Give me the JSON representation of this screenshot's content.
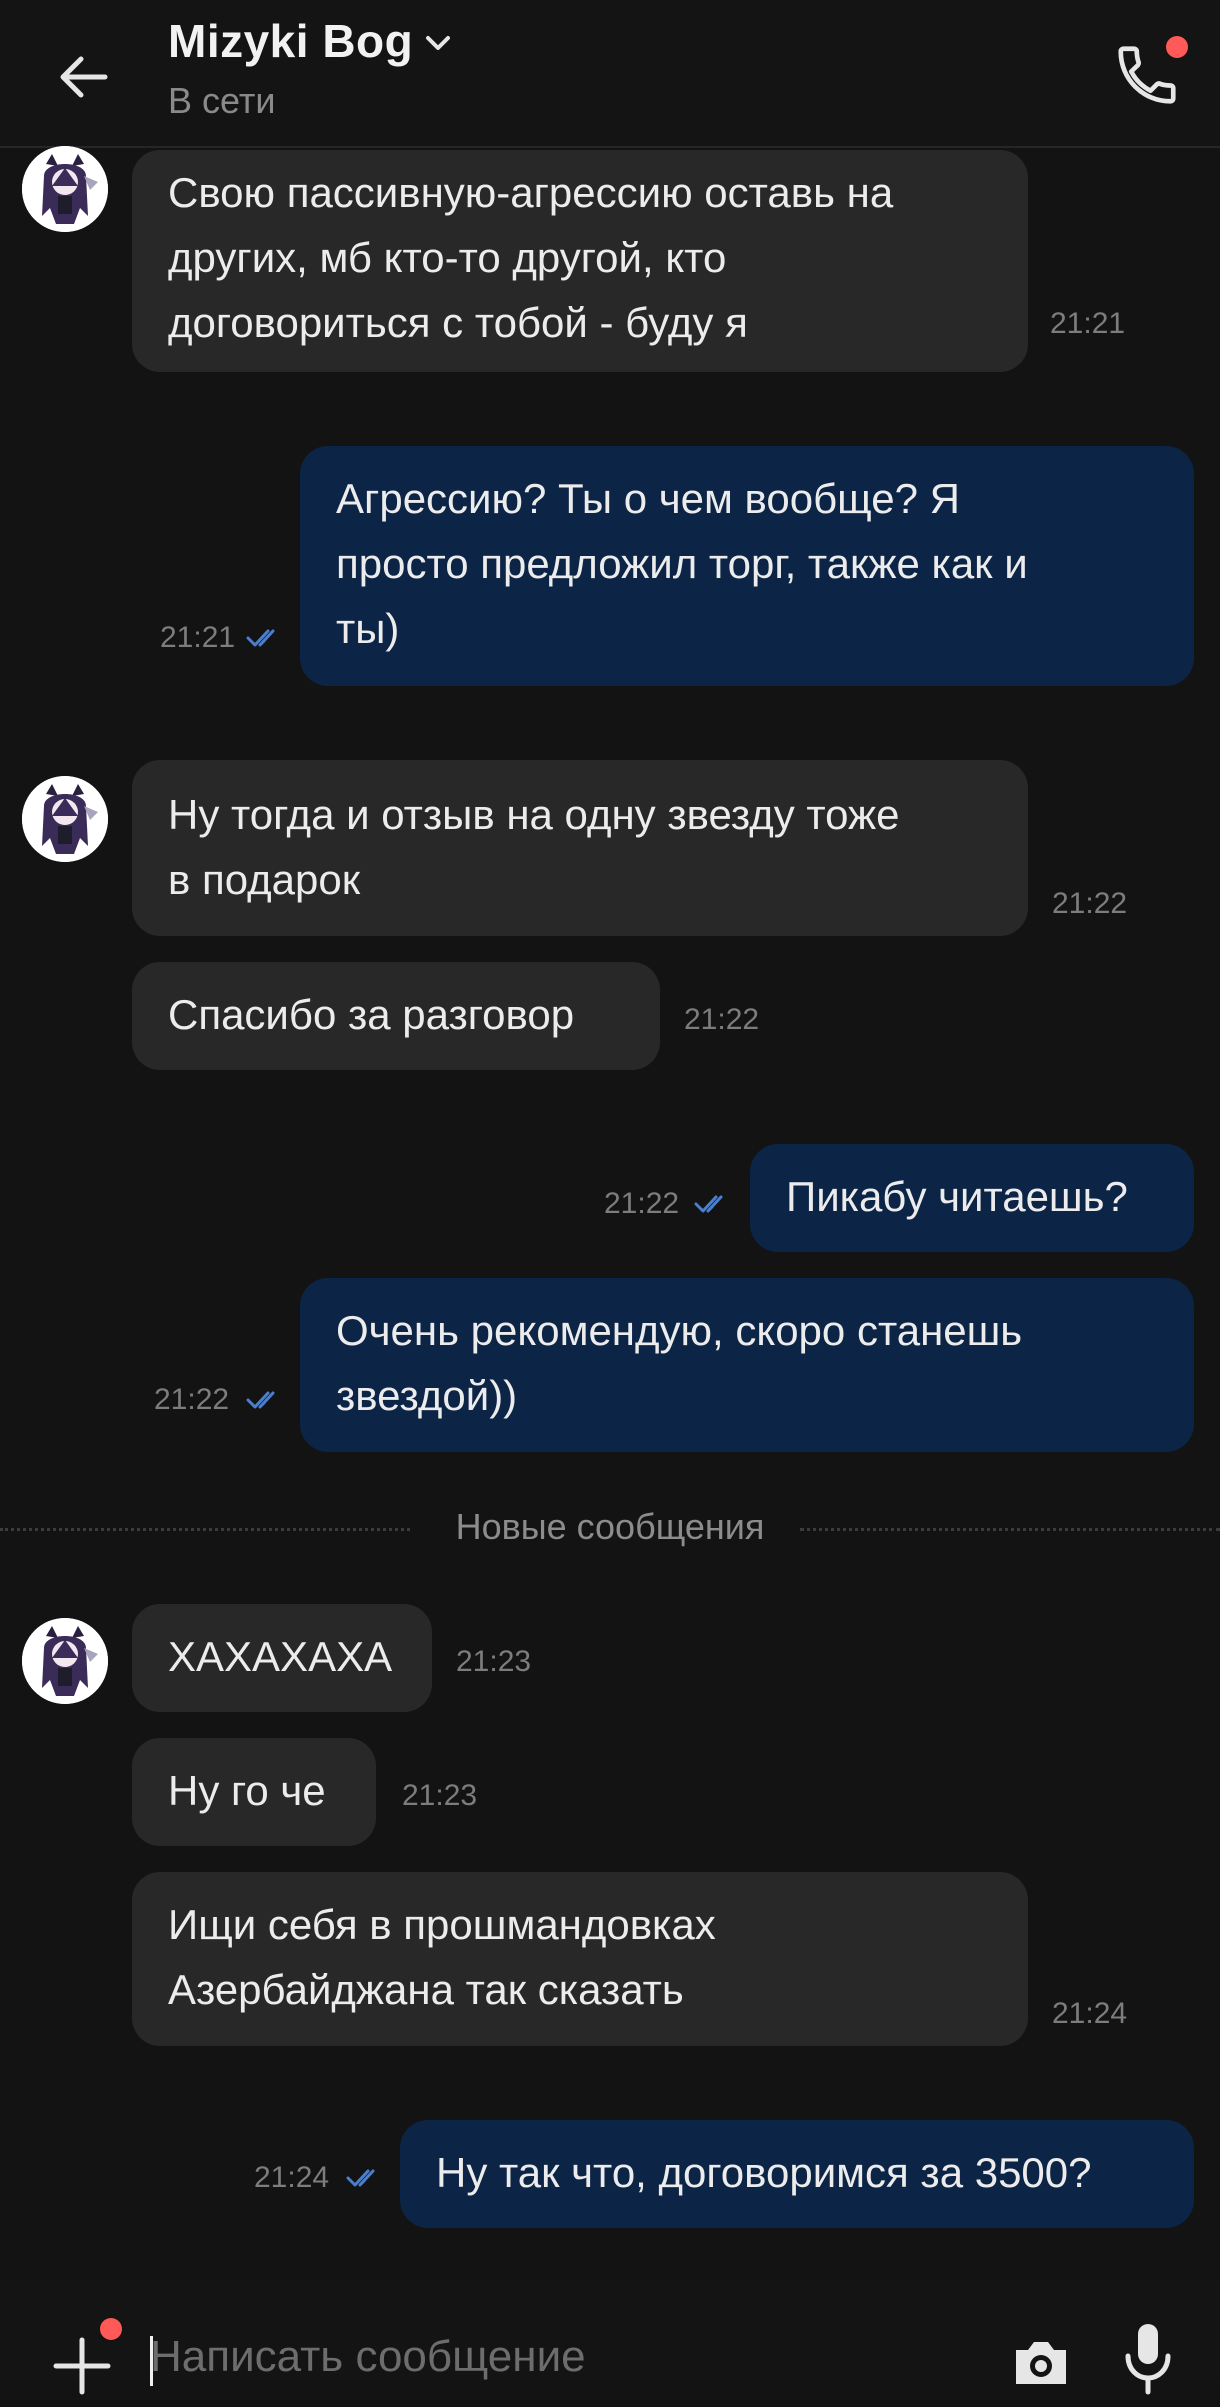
{
  "header": {
    "contact_name": "Mizyki Bog",
    "status": "В сети",
    "back_icon": "arrow-left-icon",
    "chevron_icon": "chevron-down-icon",
    "call_icon": "phone-icon",
    "accent_dot_color": "#ff5a57"
  },
  "messages": [
    {
      "direction": "in",
      "text": "Свою пассивную-агрессию оставь на\nдругих, мб кто-то другой, кто\nдоговориться с тобой - буду я",
      "time": "21:21"
    },
    {
      "direction": "out",
      "text": "Агрессию? Ты о чем вообще? Я\nпросто предложил торг, также как и\nты)",
      "time": "21:21",
      "status": "read"
    },
    {
      "direction": "in",
      "text": "Ну тогда и отзыв на одну звезду тоже\nв подарок",
      "time": "21:22"
    },
    {
      "direction": "in",
      "text": "Спасибо за разговор",
      "time": "21:22"
    },
    {
      "direction": "out",
      "text": "Пикабу читаешь?",
      "time": "21:22",
      "status": "read"
    },
    {
      "direction": "out",
      "text": "Очень рекомендую, скоро станешь\nзвездой))",
      "time": "21:22",
      "status": "read"
    },
    {
      "direction": "in",
      "text": "ХАХАХАХА",
      "time": "21:23"
    },
    {
      "direction": "in",
      "text": "Ну го че",
      "time": "21:23"
    },
    {
      "direction": "in",
      "text": "Ищи себя в прошмандовках\nАзербайджана так сказать",
      "time": "21:24"
    },
    {
      "direction": "out",
      "text": "Ну так что, договоримся за 3500?",
      "time": "21:24",
      "status": "read"
    }
  ],
  "divider": {
    "label": "Новые сообщения"
  },
  "composer": {
    "placeholder": "Написать сообщение",
    "attach_icon": "plus-icon",
    "camera_icon": "camera-icon",
    "mic_icon": "microphone-icon"
  },
  "colors": {
    "background": "#131313",
    "incoming_bubble": "#282828",
    "outgoing_bubble": "#0c2446",
    "read_ticks": "#4a7fd0"
  }
}
